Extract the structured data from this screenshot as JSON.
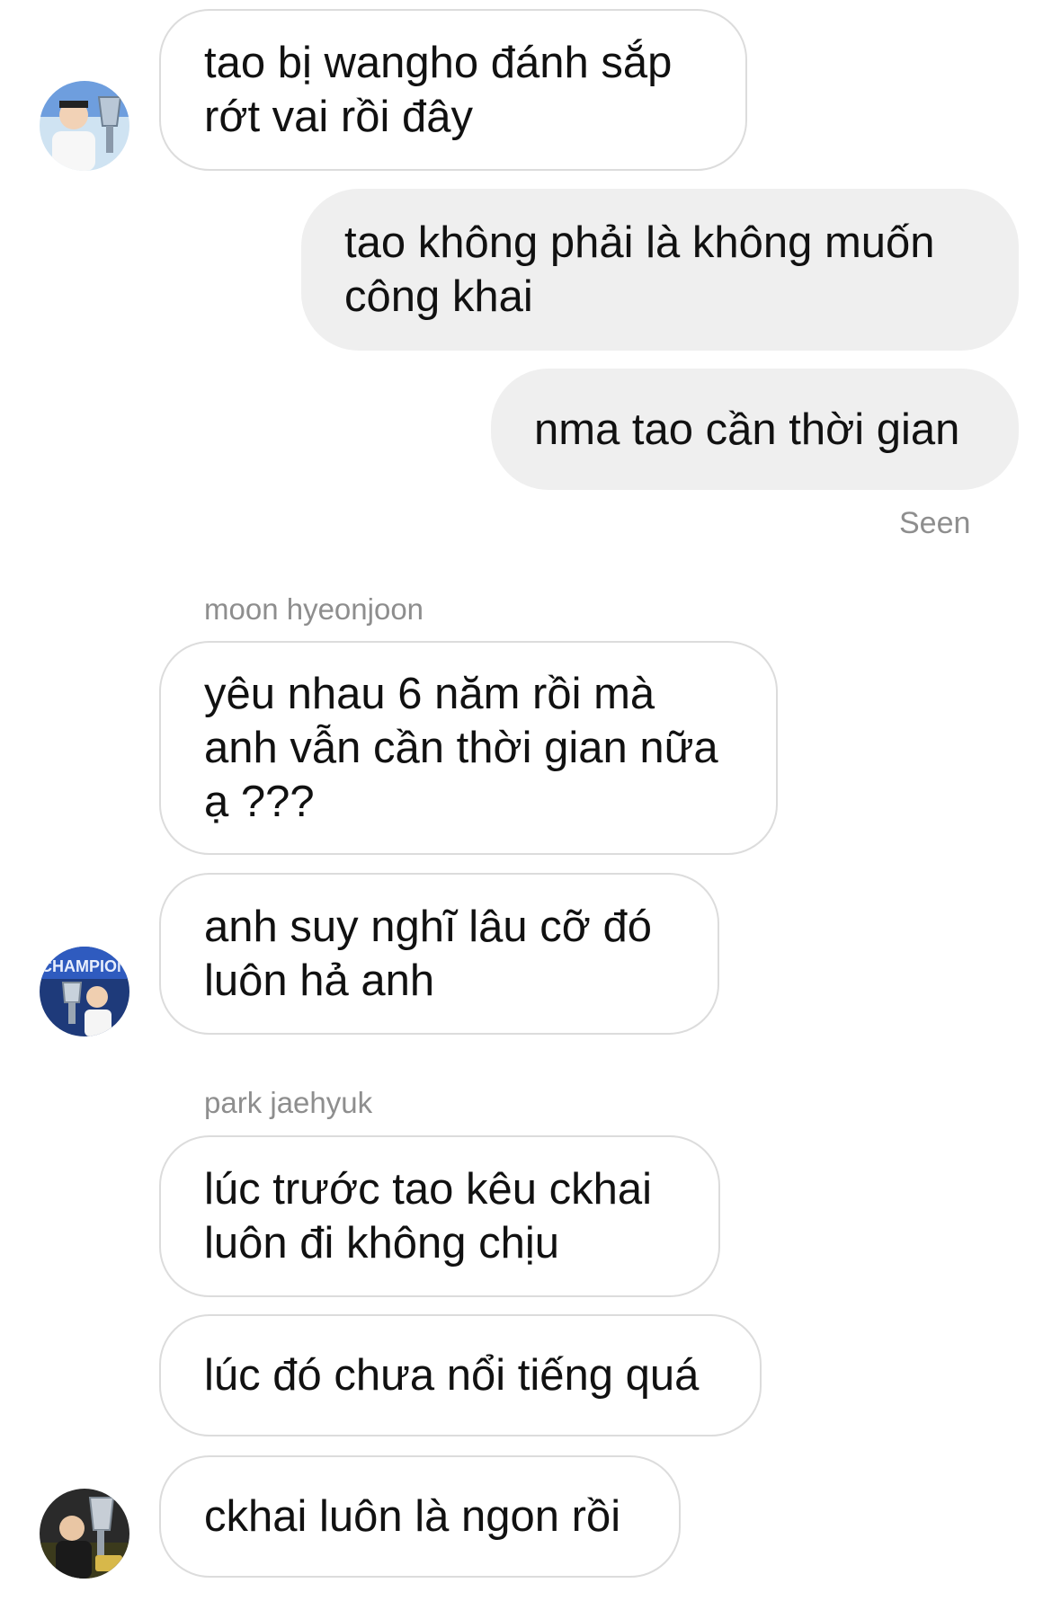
{
  "thread": {
    "messages": [
      {
        "from": "other",
        "text": "tao bị wangho đánh sắp\nrớt vai rồi đây"
      },
      {
        "from": "me",
        "text": "tao không phải là không muốn\ncông khai"
      },
      {
        "from": "me",
        "text": "nma tao cần thời gian"
      },
      {
        "from": "other",
        "text": "yêu nhau 6 năm rồi mà\nanh vẫn cần thời gian nữa\nạ ???"
      },
      {
        "from": "other",
        "text": "anh suy nghĩ lâu cỡ đó\nluôn hả anh"
      },
      {
        "from": "other",
        "text": "lúc trước tao kêu ckhai\nluôn đi không chịu"
      },
      {
        "from": "other",
        "text": "lúc đó chưa nổi tiếng quá"
      },
      {
        "from": "other",
        "text": "ckhai luôn là ngon rồi"
      }
    ],
    "seen_label": "Seen",
    "senders": [
      "moon hyeonjoon",
      "park jaehyuk"
    ]
  },
  "avatars": [
    {
      "icon": "player-with-trophy-avatar",
      "bg": "#cfe3f2"
    },
    {
      "icon": "champions-avatar",
      "bg": "#1e3a7a"
    },
    {
      "icon": "trophy-kiss-avatar",
      "bg": "#2a2a2a"
    }
  ],
  "colors": {
    "outgoing_bubble": "#efefef",
    "incoming_border": "#dcdcdc",
    "meta_text": "#8e8e8e"
  }
}
